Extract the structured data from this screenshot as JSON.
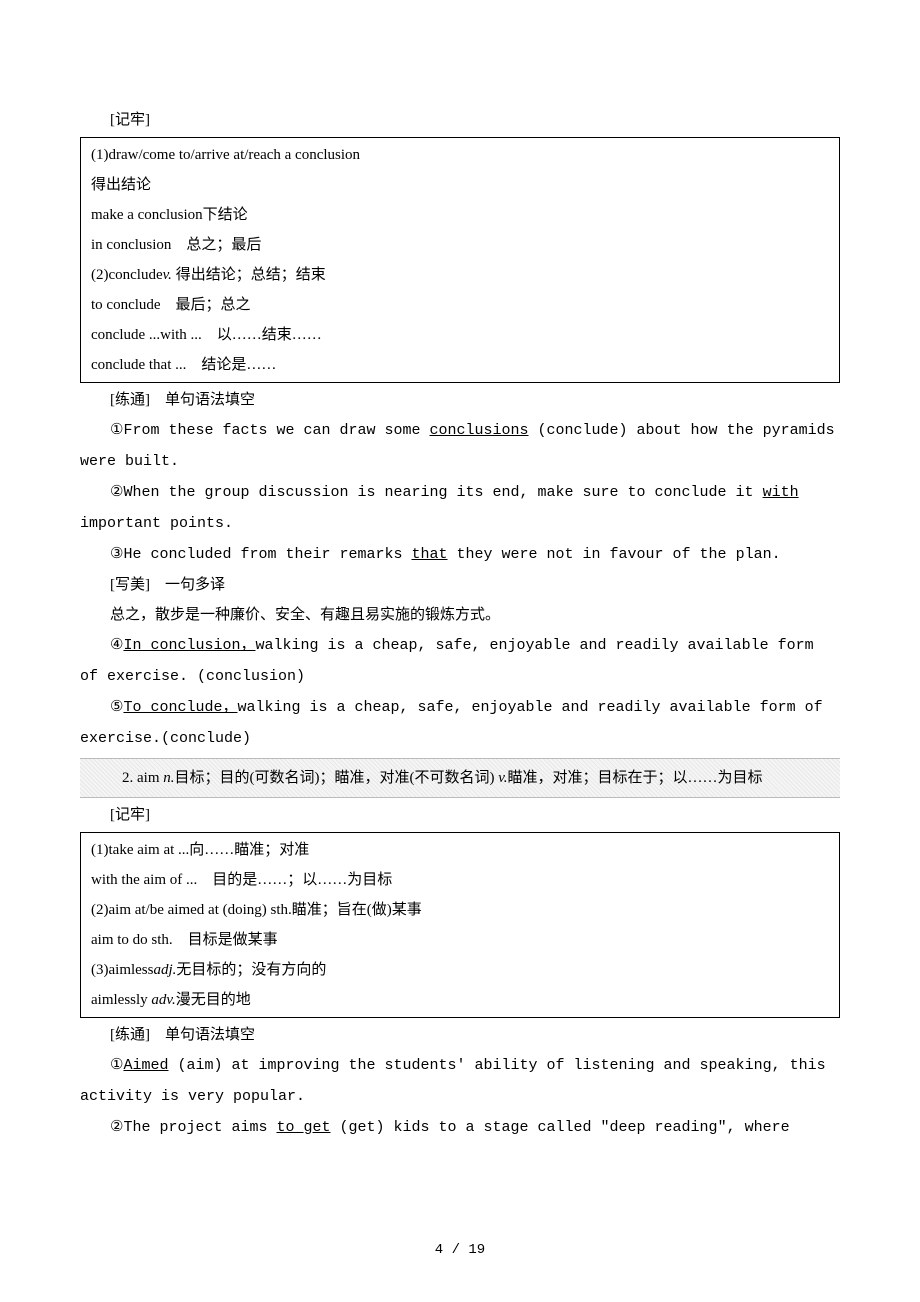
{
  "labels": {
    "remember": "[记牢]",
    "practice": "[练通]　单句语法填空",
    "write": "[写美]　一句多译"
  },
  "box1": {
    "l1": "(1)draw/come to/arrive at/reach a conclusion",
    "l2": "得出结论",
    "l3": "make a conclusion下结论",
    "l4": "in conclusion　总之；最后",
    "l5a": "(2)conclude",
    "l5b": "v.",
    "l5c": " 得出结论；总结；结束",
    "l6": "to conclude　最后；总之",
    "l7": "conclude ...with ...　以……结束……",
    "l8": "conclude that ...　结论是……"
  },
  "p1": {
    "s1a": "①From these facts we can draw some ",
    "s1u": "conclusions",
    "s1b": " (conclude) about how the pyramids were built.",
    "s2a": "②When the group discussion is nearing its end, make sure to conclude it ",
    "s2u": "with",
    "s2b": " important points.",
    "s3a": "③He concluded from their remarks ",
    "s3u": "that",
    "s3b": " they were not in favour of the plan."
  },
  "w1": {
    "prompt": "总之，散步是一种廉价、安全、有趣且易实施的锻炼方式。",
    "s4a": "④",
    "s4u": "In conclusion，",
    "s4b": "walking is a cheap, safe, enjoyable and readily available form of exercise. (conclusion)",
    "s5a": "⑤",
    "s5u": "To conclude，",
    "s5b": "walking is a cheap, safe, enjoyable and readily available form of exercise.(conclude)"
  },
  "hatch": {
    "l1a": "2. aim ",
    "l1b": "n.",
    "l1c": "目标；目的(可数名词)；瞄准，对准(不可数名词) ",
    "l1d": "v.",
    "l1e": "瞄准，对准；目标在于；以……为目标"
  },
  "box2": {
    "l1": "(1)take aim at ...向……瞄准；对准",
    "l2": "with the aim of ...　目的是……；以……为目标",
    "l3": "(2)aim at/be aimed at (doing) sth.瞄准；旨在(做)某事",
    "l4": "aim to do sth.　目标是做某事",
    "l5a": "(3)aimless",
    "l5b": "adj.",
    "l5c": "无目标的；没有方向的",
    "l6a": "aimlessly ",
    "l6b": "adv.",
    "l6c": "漫无目的地"
  },
  "p2": {
    "s1a": "①",
    "s1u": "Aimed",
    "s1b": " (aim) at improving the students' ability of listening and speaking, this activity is very popular.",
    "s2a": "②The project aims ",
    "s2u": "to get",
    "s2b": " (get) kids to a stage called \"deep reading\", where"
  },
  "pagenum": "4 / 19"
}
